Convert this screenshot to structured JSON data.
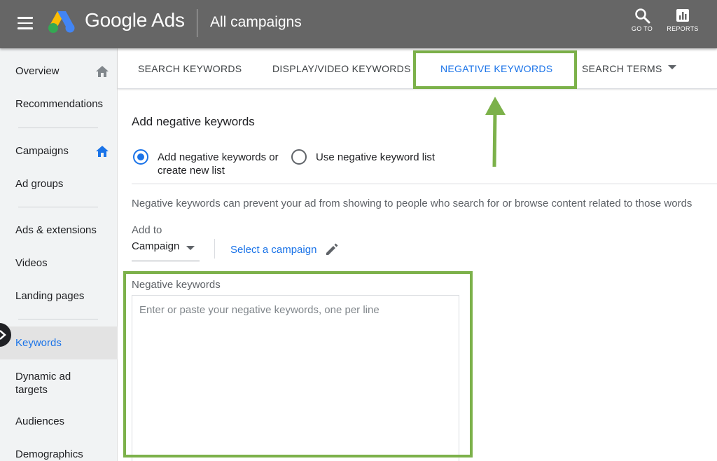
{
  "header": {
    "brand": "Google Ads",
    "page_title": "All campaigns",
    "actions": [
      {
        "label": "GO TO",
        "icon": "search-icon"
      },
      {
        "label": "REPORTS",
        "icon": "reports-icon"
      }
    ]
  },
  "sidebar": {
    "items": [
      {
        "label": "Overview",
        "icon": "home-icon"
      },
      {
        "label": "Recommendations"
      },
      {
        "label": "Campaigns",
        "icon": "home-icon"
      },
      {
        "label": "Ad groups"
      },
      {
        "label": "Ads & extensions"
      },
      {
        "label": "Videos"
      },
      {
        "label": "Landing pages"
      },
      {
        "label": "Keywords",
        "active": true
      },
      {
        "label": "Dynamic ad targets"
      },
      {
        "label": "Audiences"
      },
      {
        "label": "Demographics"
      }
    ]
  },
  "tabs": [
    {
      "label": "SEARCH KEYWORDS"
    },
    {
      "label": "DISPLAY/VIDEO KEYWORDS"
    },
    {
      "label": "NEGATIVE KEYWORDS",
      "active": true
    },
    {
      "label": "SEARCH TERMS"
    }
  ],
  "content": {
    "title": "Add negative keywords",
    "radio_options": [
      {
        "line1": "Add negative keywords or",
        "line2": "create new list",
        "checked": true
      },
      {
        "line1": "Use negative keyword list",
        "checked": false
      }
    ],
    "description": "Negative keywords can prevent your ad from showing to people who search for or browse content related to those words",
    "add_to_label": "Add to",
    "add_to_value": "Campaign",
    "select_campaign": "Select a campaign",
    "negative_keywords_label": "Negative keywords",
    "negative_keywords_placeholder": "Enter or paste your negative keywords, one per line",
    "negative_keywords_value": ""
  },
  "colors": {
    "header_bg": "#666666",
    "accent": "#1a73e8",
    "highlight": "#7cb14a"
  }
}
